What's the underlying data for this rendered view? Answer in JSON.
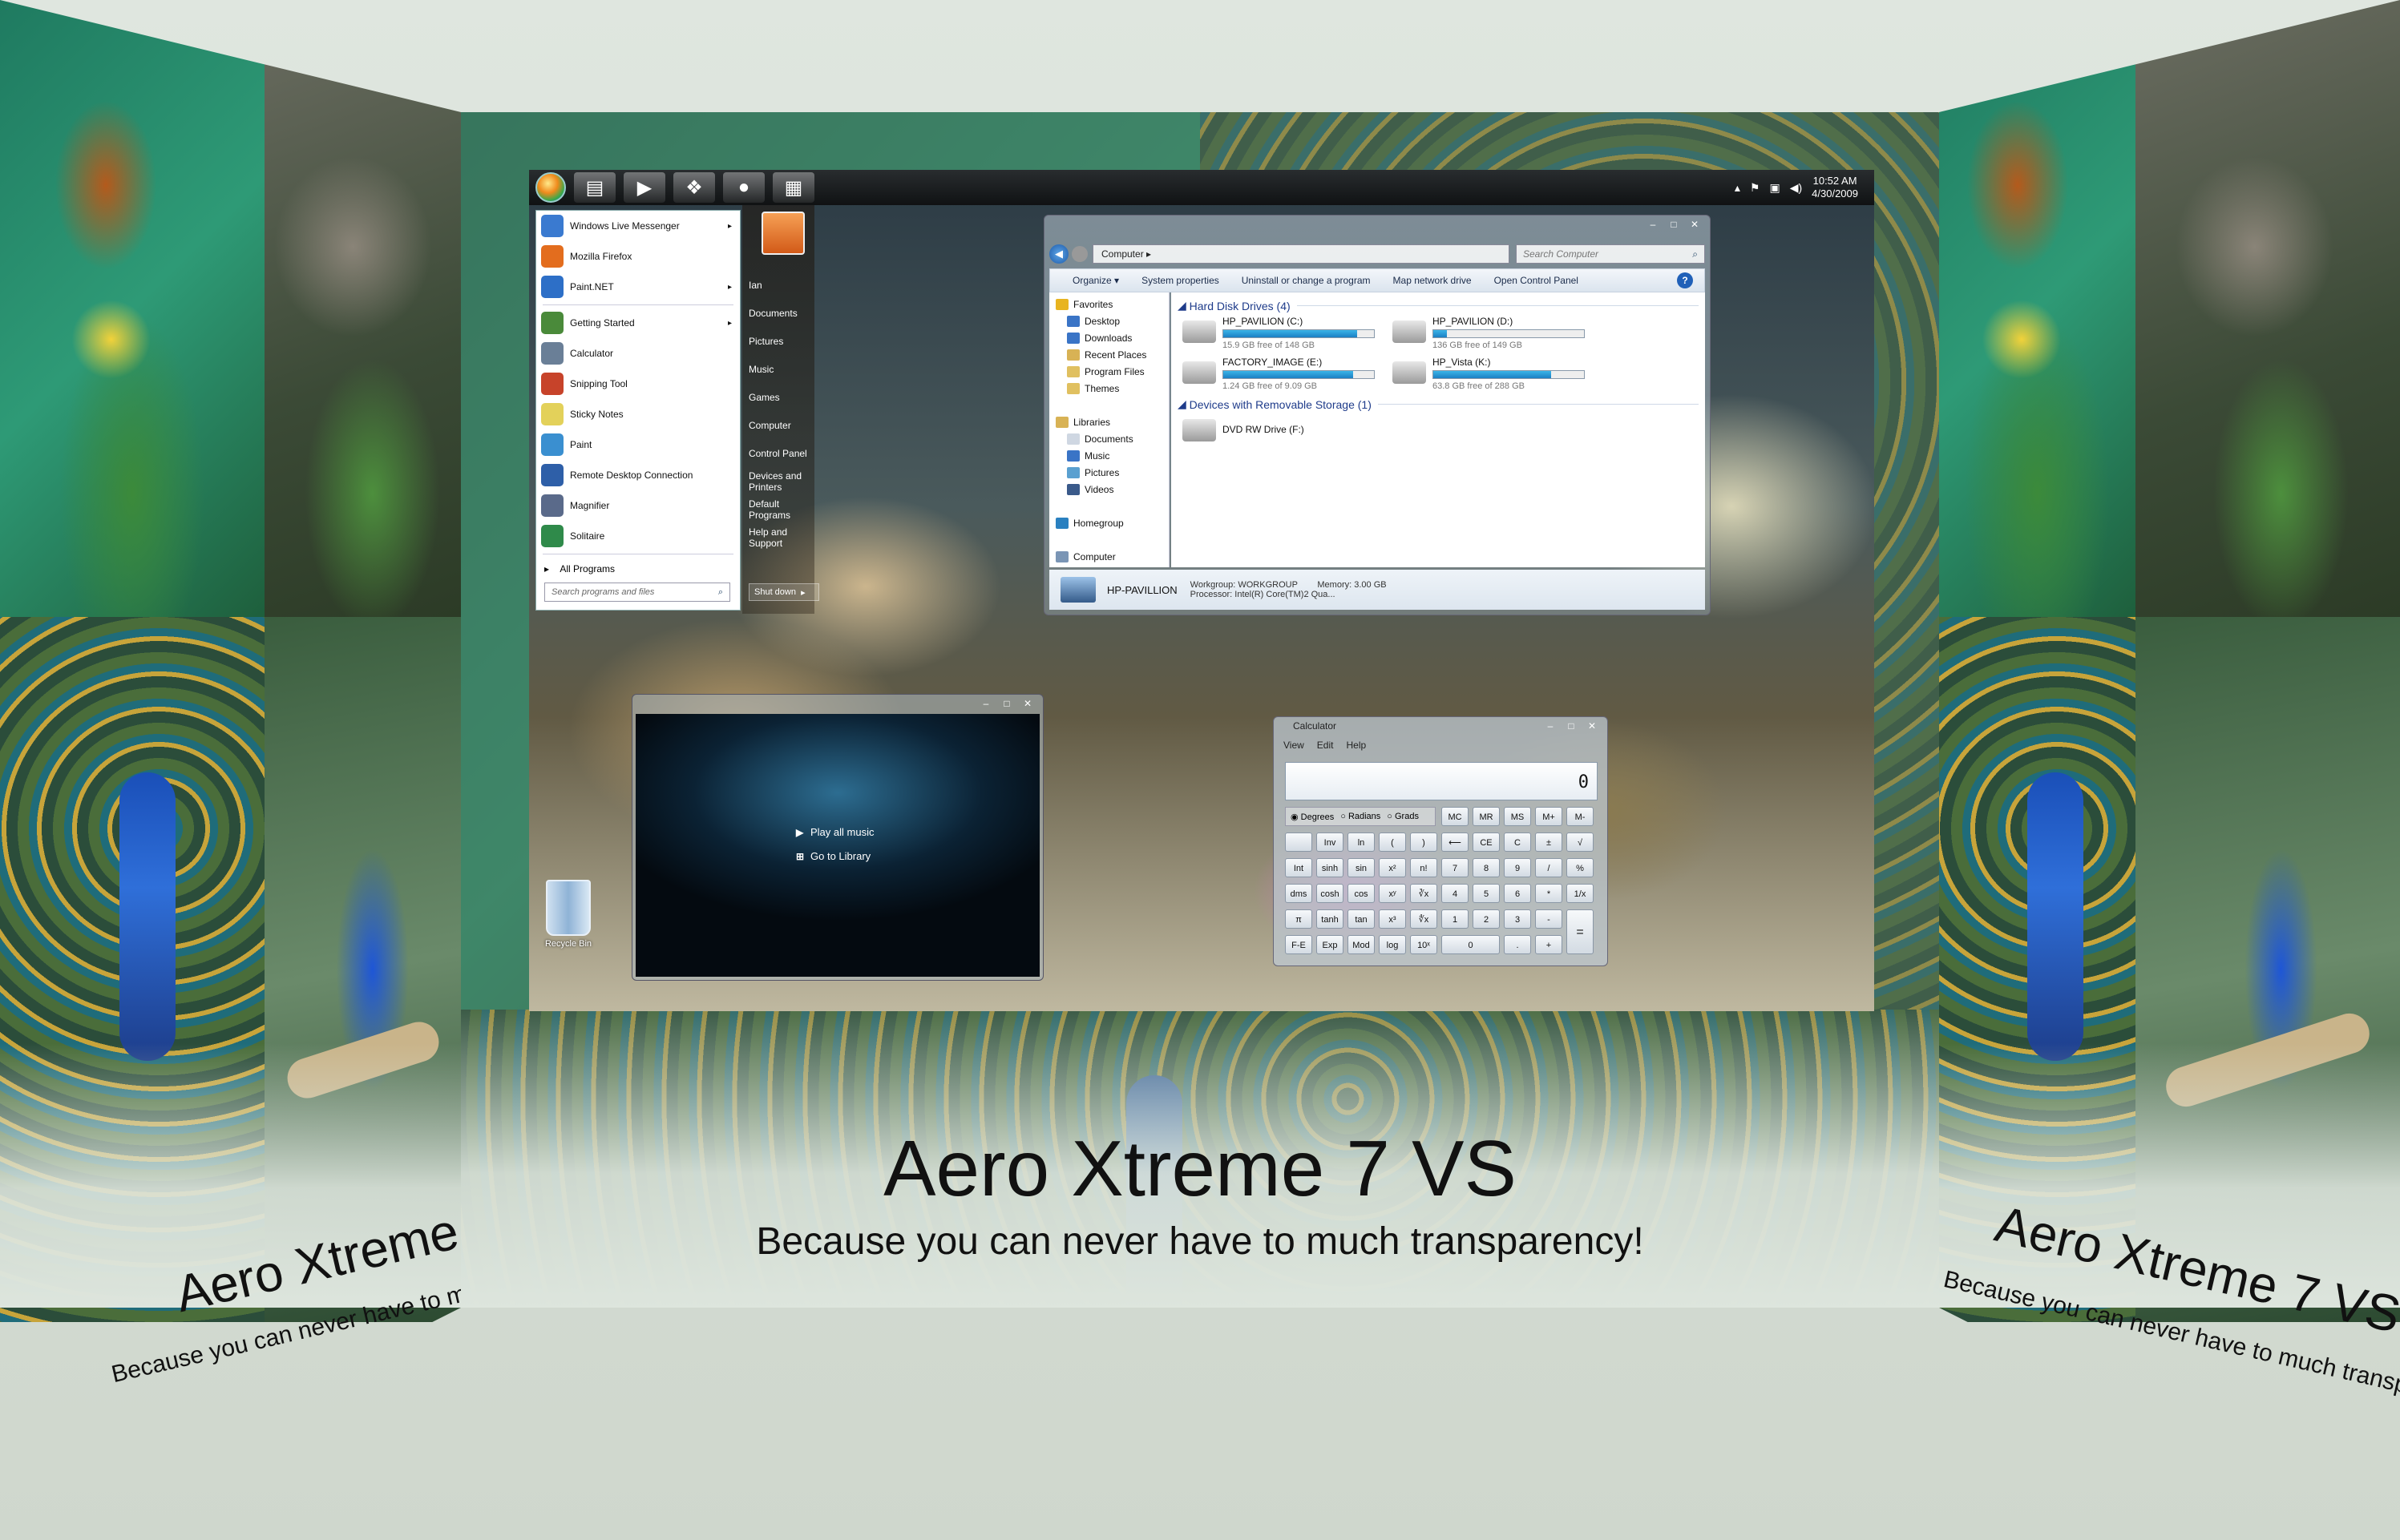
{
  "banner": {
    "title": "Aero Xtreme 7 VS",
    "subtitle": "Because you can never have to much transparency!"
  },
  "taskbar": {
    "clock_time": "10:52 AM",
    "clock_date": "4/30/2009"
  },
  "start_menu": {
    "items": [
      {
        "label": "Windows Live Messenger",
        "arrow": "▸",
        "color": "#3a7ad0"
      },
      {
        "label": "Mozilla Firefox",
        "arrow": "",
        "color": "#e36d1e"
      },
      {
        "label": "Paint.NET",
        "arrow": "▸",
        "color": "#2d6fc7"
      },
      {
        "label": "Getting Started",
        "arrow": "▸",
        "color": "#4a8a3a"
      },
      {
        "label": "Calculator",
        "arrow": "",
        "color": "#6a7f97"
      },
      {
        "label": "Snipping Tool",
        "arrow": "",
        "color": "#c7432a"
      },
      {
        "label": "Sticky Notes",
        "arrow": "",
        "color": "#e3d15a"
      },
      {
        "label": "Paint",
        "arrow": "",
        "color": "#3a8fd0"
      },
      {
        "label": "Remote Desktop Connection",
        "arrow": "",
        "color": "#2e5fa8"
      },
      {
        "label": "Magnifier",
        "arrow": "",
        "color": "#5a6a8a"
      },
      {
        "label": "Solitaire",
        "arrow": "",
        "color": "#2f8a4a"
      }
    ],
    "all_programs": "All Programs",
    "search_placeholder": "Search programs and files",
    "right_links": [
      "Ian",
      "Documents",
      "Pictures",
      "Music",
      "Games",
      "Computer",
      "Control Panel",
      "Devices and Printers",
      "Default Programs",
      "Help and Support"
    ],
    "shutdown": "Shut down"
  },
  "explorer": {
    "address": "Computer ▸",
    "search_placeholder": "Search Computer",
    "commands": [
      "Organize ▾",
      "System properties",
      "Uninstall or change a program",
      "Map network drive",
      "Open Control Panel"
    ],
    "nav": [
      {
        "label": "Favorites",
        "indent": 0,
        "color": "#e8b420"
      },
      {
        "label": "Desktop",
        "indent": 1,
        "color": "#3a74c6"
      },
      {
        "label": "Downloads",
        "indent": 1,
        "color": "#3a74c6"
      },
      {
        "label": "Recent Places",
        "indent": 1,
        "color": "#d8b255"
      },
      {
        "label": "Program Files",
        "indent": 1,
        "color": "#e0c060"
      },
      {
        "label": "Themes",
        "indent": 1,
        "color": "#e0c060"
      },
      {
        "label": "",
        "indent": 0,
        "color": ""
      },
      {
        "label": "Libraries",
        "indent": 0,
        "color": "#d8b255"
      },
      {
        "label": "Documents",
        "indent": 1,
        "color": "#cfd7e2"
      },
      {
        "label": "Music",
        "indent": 1,
        "color": "#3a74c6"
      },
      {
        "label": "Pictures",
        "indent": 1,
        "color": "#5aa0d0"
      },
      {
        "label": "Videos",
        "indent": 1,
        "color": "#3a5a8a"
      },
      {
        "label": "",
        "indent": 0,
        "color": ""
      },
      {
        "label": "Homegroup",
        "indent": 0,
        "color": "#2a80c0"
      },
      {
        "label": "",
        "indent": 0,
        "color": ""
      },
      {
        "label": "Computer",
        "indent": 0,
        "color": "#7a95b5"
      }
    ],
    "group_hdd": "Hard Disk Drives (4)",
    "drives": [
      {
        "name": "HP_PAVILION (C:)",
        "free": "15.9 GB free of 148 GB",
        "used_fraction": 0.89
      },
      {
        "name": "HP_PAVILION (D:)",
        "free": "136 GB free of 149 GB",
        "used_fraction": 0.09
      },
      {
        "name": "FACTORY_IMAGE (E:)",
        "free": "1.24 GB free of 9.09 GB",
        "used_fraction": 0.86
      },
      {
        "name": "HP_Vista (K:)",
        "free": "63.8 GB free of 288 GB",
        "used_fraction": 0.78
      }
    ],
    "group_removable": "Devices with Removable Storage (1)",
    "dvd": "DVD RW Drive (F:)",
    "details": {
      "pc_name": "HP-PAVILLION",
      "workgroup": "Workgroup: WORKGROUP",
      "memory": "Memory: 3.00 GB",
      "processor": "Processor: Intel(R) Core(TM)2 Qua..."
    }
  },
  "media_player": {
    "play_all": "Play all music",
    "library": "Go to Library"
  },
  "calculator": {
    "title": "Calculator",
    "menus": [
      "View",
      "Edit",
      "Help"
    ],
    "display": "0",
    "radios": [
      "Degrees",
      "Radians",
      "Grads"
    ],
    "keys": [
      [
        "",
        "",
        "",
        "",
        "",
        "MC",
        "MR",
        "MS",
        "M+",
        "M-"
      ],
      [
        "",
        "Inv",
        "ln",
        "(",
        ")",
        "⟵",
        "CE",
        "C",
        "±",
        "√"
      ],
      [
        "Int",
        "sinh",
        "sin",
        "x²",
        "n!",
        "7",
        "8",
        "9",
        "/",
        "%"
      ],
      [
        "dms",
        "cosh",
        "cos",
        "xʸ",
        "∛x",
        "4",
        "5",
        "6",
        "*",
        "1/x"
      ],
      [
        "π",
        "tanh",
        "tan",
        "x³",
        "∜x",
        "1",
        "2",
        "3",
        "-",
        "="
      ],
      [
        "F-E",
        "Exp",
        "Mod",
        "log",
        "10ˣ",
        "0",
        "",
        ".",
        "+",
        ""
      ]
    ]
  },
  "recycle_bin": "Recycle Bin"
}
